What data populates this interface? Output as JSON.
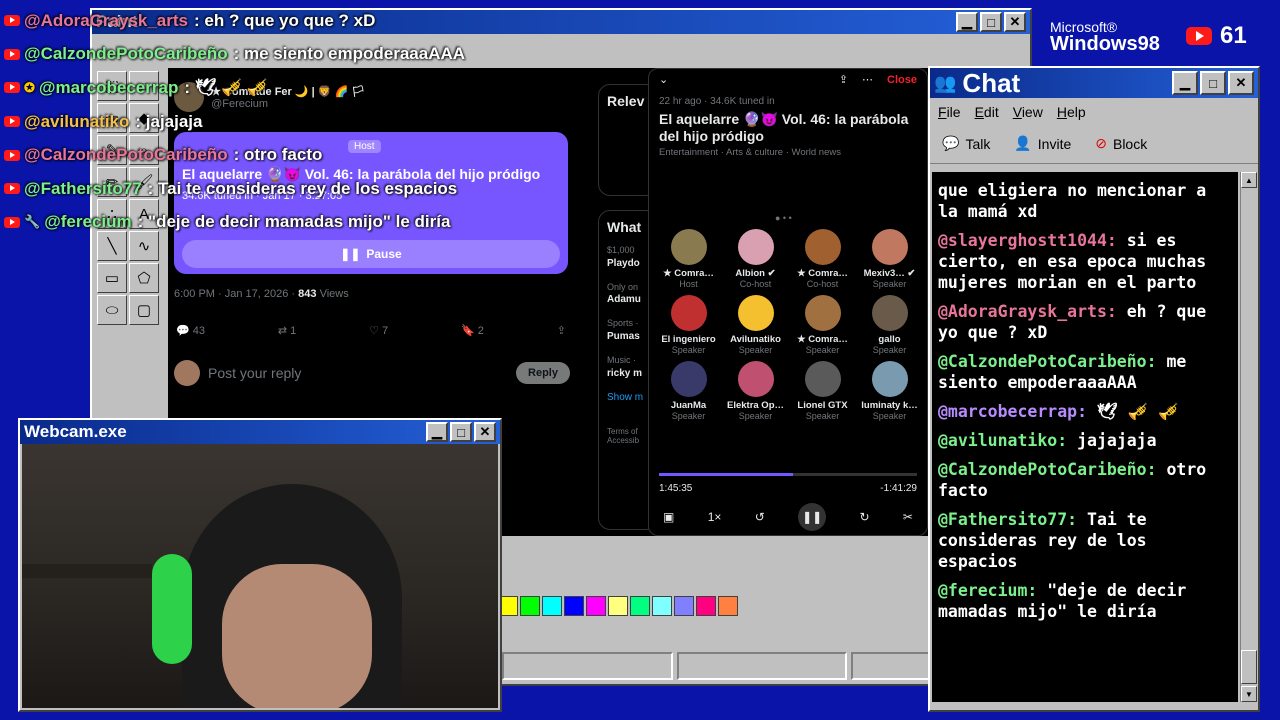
{
  "paint": {
    "title": "Paint"
  },
  "overlay_chat": [
    {
      "user": "@AdoraGraysk_arts",
      "msg": ": eh ? que yo que ? xD",
      "color": "#e8769a",
      "badge": ""
    },
    {
      "user": "@CalzondePotoCaribeño",
      "msg": ": me siento empoderaaaAAA",
      "color": "#7cf08c",
      "badge": ""
    },
    {
      "user": "@marcobecerrap",
      "msg": ": 🕊 🎺 🎺",
      "color": "#7cf08c",
      "badge": "✪"
    },
    {
      "user": "@avilunatiko",
      "msg": ": jajajaja",
      "color": "#f4c04c",
      "badge": ""
    },
    {
      "user": "@CalzondePotoCaribeño",
      "msg": ": otro facto",
      "color": "#e8769a",
      "badge": ""
    },
    {
      "user": "@Fathersito77",
      "msg": ": Tai te consideras rey de los espacios",
      "color": "#7cf08c",
      "badge": ""
    },
    {
      "user": "@ferecium",
      "msg": ": \"deje de decir mamadas mijo\" le diría",
      "color": "#7cf08c",
      "badge": "🔧"
    }
  ],
  "tweet": {
    "author": "★ Comrade Fer 🌙 | 🦁 🌈 🏳",
    "handle": "@Ferecium",
    "host_label": "Host",
    "space_title": "El aquelarre 🔮😈 Vol. 46: la parábola del hijo pródigo",
    "tuned_in": "34.6K tuned in · Jan 17 · 3:27:05",
    "pause_label": "Pause",
    "meta": "6:00 PM · Jan 17, 2026 ·",
    "views_count": "843",
    "views_label": "Views",
    "replies": "43",
    "reposts": "1",
    "likes": "7",
    "bookmarks": "2",
    "reply_placeholder": "Post your reply",
    "reply_button": "Reply"
  },
  "side": {
    "relevant": "Relev",
    "whats": "What",
    "items": [
      {
        "title": "Playdo",
        "sub": "$1,000"
      },
      {
        "title": "Adamu",
        "sub": "Only on"
      },
      {
        "title": "Pumas",
        "sub": "Sports ·"
      },
      {
        "title": "ricky m",
        "sub": "Music ·"
      }
    ],
    "show_more": "Show m",
    "terms": "Terms of",
    "access": "Accessib"
  },
  "spaces": {
    "close": "Close",
    "ago": "22 hr ago · 34.6K tuned in",
    "title": "El aquelarre 🔮😈 Vol. 46: la parábola del hijo pródigo",
    "categories": "Entertainment · Arts & culture · World news",
    "participants": [
      {
        "name": "★ Comra…",
        "role": "Host",
        "color": "#8a7a50"
      },
      {
        "name": "Albion ✔",
        "role": "Co-host",
        "color": "#d8a0b0"
      },
      {
        "name": "★ Comra…",
        "role": "Co-host",
        "color": "#a06030"
      },
      {
        "name": "Mexiv3… ✔",
        "role": "Speaker",
        "color": "#c07860"
      },
      {
        "name": "El ingeniero",
        "role": "Speaker",
        "color": "#c03030"
      },
      {
        "name": "Avilunatiko",
        "role": "Speaker",
        "color": "#f4c030"
      },
      {
        "name": "★ Comra…",
        "role": "Speaker",
        "color": "#a07040"
      },
      {
        "name": "gallo",
        "role": "Speaker",
        "color": "#6a5a4a"
      },
      {
        "name": "JuanMa",
        "role": "Speaker",
        "color": "#3a3a6a"
      },
      {
        "name": "Elektra Op…",
        "role": "Speaker",
        "color": "#c05070"
      },
      {
        "name": "Lionel GTX",
        "role": "Speaker",
        "color": "#5a5a5a"
      },
      {
        "name": "luminaty k…",
        "role": "Speaker",
        "color": "#7a9ab0"
      }
    ],
    "progress": 0.52,
    "elapsed": "1:45:35",
    "remaining": "-1:41:29",
    "speed": "1×"
  },
  "webcam": {
    "title": "Webcam.exe"
  },
  "win98": {
    "brand1": "Microsoft®",
    "brand2": "Windows98"
  },
  "viewer_count": "61",
  "chat": {
    "title": "Chat",
    "menu": [
      "File",
      "Edit",
      "View",
      "Help"
    ],
    "toolbar": {
      "talk": "Talk",
      "invite": "Invite",
      "block": "Block"
    },
    "messages": [
      {
        "user": "",
        "text": "que eligiera no mencionar a la mamá xd",
        "color": "#ffffff"
      },
      {
        "user": "@slayerghostt1044:",
        "text": "si es cierto, en esa epoca muchas mujeres morian en el parto",
        "color": "#e8769a"
      },
      {
        "user": "@AdoraGraysk_arts:",
        "text": "eh ? que yo que ? xD",
        "color": "#e8769a"
      },
      {
        "user": "@CalzondePotoCaribeño:",
        "text": "me siento empoderaaaAAA",
        "color": "#7cf08c"
      },
      {
        "user": "@marcobecerrap:",
        "text": "🕊 🎺 🎺",
        "color": "#b88cff"
      },
      {
        "user": "@avilunatiko:",
        "text": "jajajaja",
        "color": "#7cf08c"
      },
      {
        "user": "@CalzondePotoCaribeño:",
        "text": "otro facto",
        "color": "#7cf08c"
      },
      {
        "user": "@Fathersito77:",
        "text": "Tai te consideras rey de los espacios",
        "color": "#7cf08c"
      },
      {
        "user": "@ferecium:",
        "text": "\"deje de decir mamadas mijo\" le diría",
        "color": "#7cf08c"
      }
    ]
  },
  "palette": [
    "#ffff00",
    "#00ff00",
    "#00ffff",
    "#0000ff",
    "#ff00ff",
    "#ffff80",
    "#00ff80",
    "#80ffff",
    "#8080ff",
    "#ff0080",
    "#ff8040"
  ]
}
